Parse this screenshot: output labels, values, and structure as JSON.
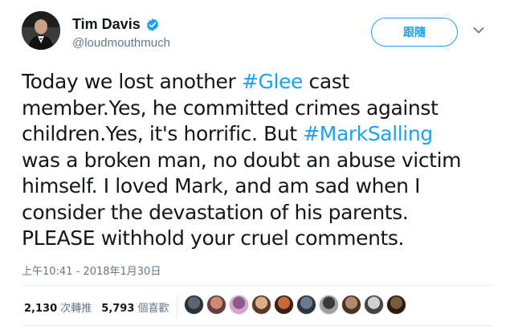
{
  "author": {
    "name": "Tim Davis",
    "handle": "@loudmouthmuch",
    "verified": true,
    "avatar_icon": "profile-photo-avatar"
  },
  "follow_label": "跟隨",
  "caret_icon": "chevron-down-icon",
  "tweet": {
    "lines": [
      [
        {
          "t": "Today we lost another ",
          "h": false
        },
        {
          "t": "#Glee",
          "h": true
        },
        {
          "t": " cast",
          "h": false
        }
      ],
      [
        {
          "t": "member.Yes, he committed crimes against",
          "h": false
        }
      ],
      [
        {
          "t": "children.Yes, it's horrific. But ",
          "h": false
        },
        {
          "t": "#MarkSalling",
          "h": true
        }
      ],
      [
        {
          "t": "was a broken man, no doubt an abuse victim",
          "h": false
        }
      ],
      [
        {
          "t": "himself. I loved Mark, and am sad when I",
          "h": false
        }
      ],
      [
        {
          "t": "consider the devastation of his parents.",
          "h": false
        }
      ],
      [
        {
          "t": "PLEASE withhold your cruel comments.",
          "h": false
        }
      ]
    ]
  },
  "timestamp": "上午10:41 - 2018年1月30日",
  "stats": {
    "retweets_count": "2,130",
    "retweets_label": "次轉推",
    "likes_count": "5,793",
    "likes_label": "個喜歡"
  },
  "likers": [
    {
      "color": "#5a6470",
      "accent": "#2b2f36"
    },
    {
      "color": "#c98a7a",
      "accent": "#6b3a3a"
    },
    {
      "color": "#8a5a8c",
      "accent": "#d9a3c7"
    },
    {
      "color": "#d7b08a",
      "accent": "#5a3a24"
    },
    {
      "color": "#c46a3a",
      "accent": "#3a1f12"
    },
    {
      "color": "#6a7a8c",
      "accent": "#2b3340"
    },
    {
      "color": "#3a3a3a",
      "accent": "#a0a0a0"
    },
    {
      "color": "#b08a6a",
      "accent": "#4a3322"
    },
    {
      "color": "#d0d0d0",
      "accent": "#444444"
    },
    {
      "color": "#7a5a3a",
      "accent": "#2a1a0e"
    }
  ],
  "colors": {
    "accent": "#1da1f2",
    "text": "#14171a",
    "muted": "#657786"
  }
}
